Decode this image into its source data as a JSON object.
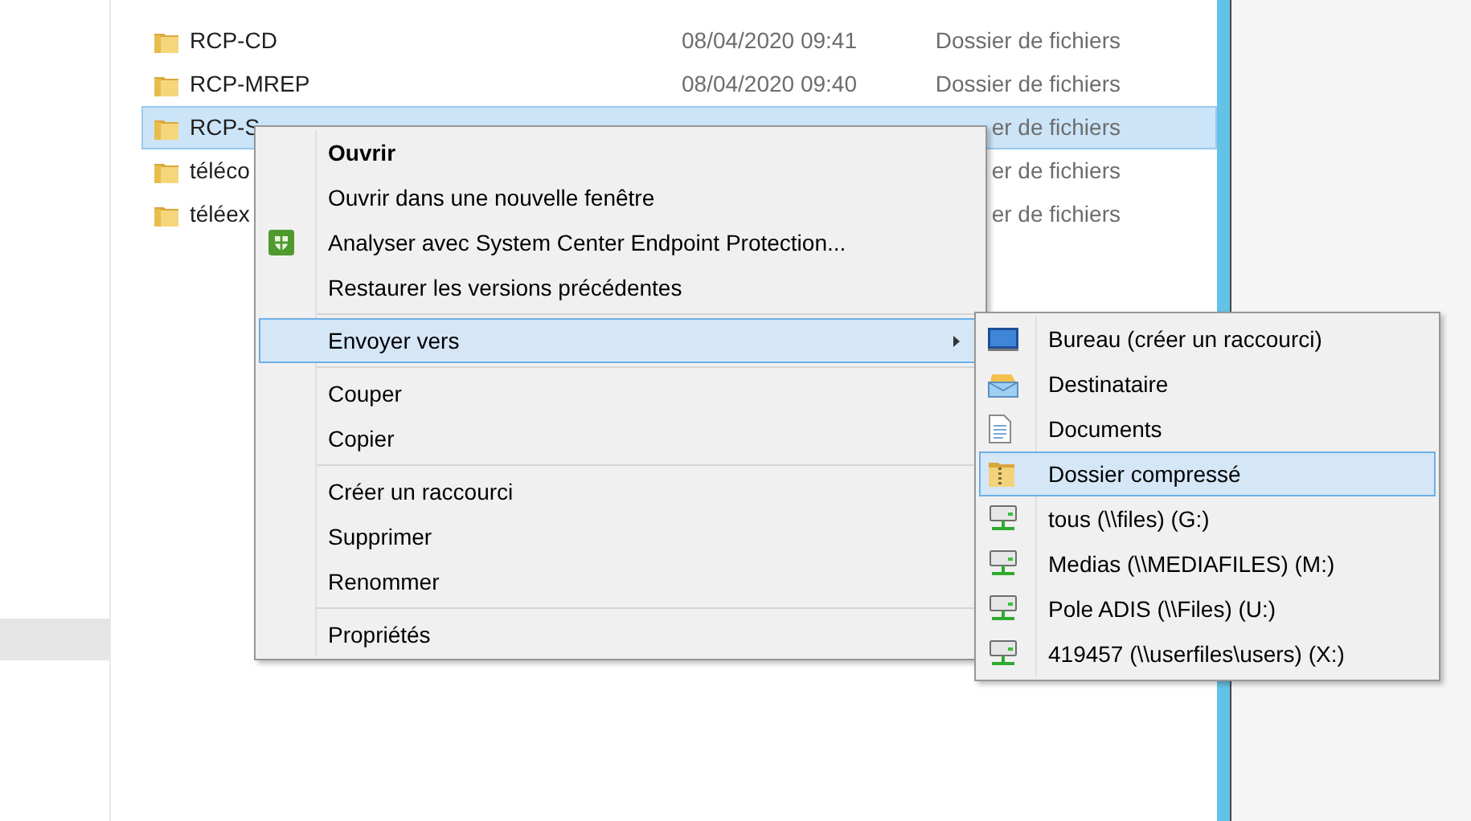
{
  "files": [
    {
      "name": "RCP-CD",
      "modified": "08/04/2020 09:41",
      "type": "Dossier de fichiers",
      "selected": false
    },
    {
      "name": "RCP-MREP",
      "modified": "08/04/2020 09:40",
      "type": "Dossier de fichiers",
      "selected": false
    },
    {
      "name": "RCP-S",
      "type": "er de fichiers",
      "selected": true
    },
    {
      "name": "téléco",
      "type": "er de fichiers",
      "selected": false
    },
    {
      "name": "téléex",
      "type": "er de fichiers",
      "selected": false
    }
  ],
  "context_menu": {
    "groups": [
      [
        {
          "label": "Ouvrir",
          "kind": "default",
          "selected": false
        },
        {
          "label": "Ouvrir dans une nouvelle fenêtre",
          "kind": "command",
          "selected": false
        },
        {
          "label": "Analyser avec System Center Endpoint Protection...",
          "kind": "scan",
          "selected": false
        },
        {
          "label": "Restaurer les versions précédentes",
          "kind": "command",
          "selected": false
        }
      ],
      [
        {
          "label": "Envoyer vers",
          "kind": "submenu",
          "selected": true
        }
      ],
      [
        {
          "label": "Couper",
          "kind": "command",
          "selected": false
        },
        {
          "label": "Copier",
          "kind": "command",
          "selected": false
        }
      ],
      [
        {
          "label": "Créer un raccourci",
          "kind": "command",
          "selected": false
        },
        {
          "label": "Supprimer",
          "kind": "command",
          "selected": false
        },
        {
          "label": "Renommer",
          "kind": "command",
          "selected": false
        }
      ],
      [
        {
          "label": "Propriétés",
          "kind": "command",
          "selected": false
        }
      ]
    ]
  },
  "send_to_menu": {
    "items": [
      {
        "label": "Bureau (créer un raccourci)",
        "kind": "desktop",
        "selected": false
      },
      {
        "label": "Destinataire",
        "kind": "mail",
        "selected": false
      },
      {
        "label": "Documents",
        "kind": "document",
        "selected": false
      },
      {
        "label": "Dossier compressé",
        "kind": "zip",
        "selected": true
      },
      {
        "label": "tous (\\\\files) (G:)",
        "kind": "drive",
        "selected": false
      },
      {
        "label": "Medias (\\\\MEDIAFILES) (M:)",
        "kind": "drive",
        "selected": false
      },
      {
        "label": "Pole ADIS (\\\\Files) (U:)",
        "kind": "drive",
        "selected": false
      },
      {
        "label": "419457 (\\\\userfiles\\users) (X:)",
        "kind": "drive",
        "selected": false
      }
    ]
  }
}
